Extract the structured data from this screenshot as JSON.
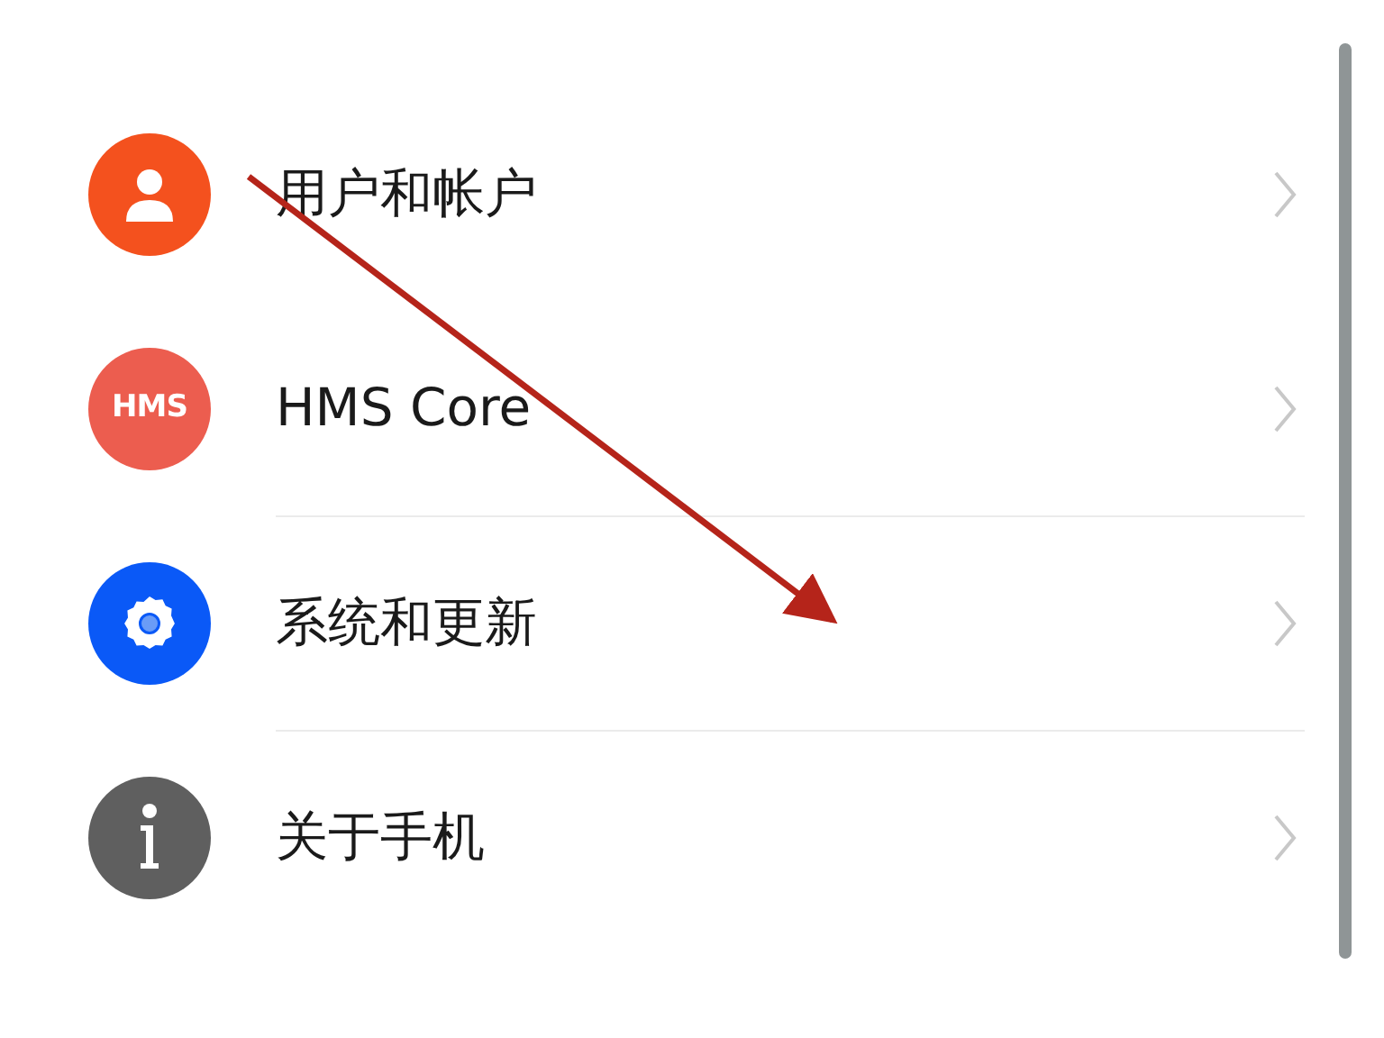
{
  "settings_items": [
    {
      "label": "用户和帐户",
      "kind": "person",
      "divider_above": false
    },
    {
      "label": "HMS Core",
      "kind": "hms",
      "icon_text": "HMS",
      "divider_above": false
    },
    {
      "label": "系统和更新",
      "kind": "gear",
      "divider_above": true
    },
    {
      "label": "关于手机",
      "kind": "info",
      "divider_above": true
    }
  ]
}
